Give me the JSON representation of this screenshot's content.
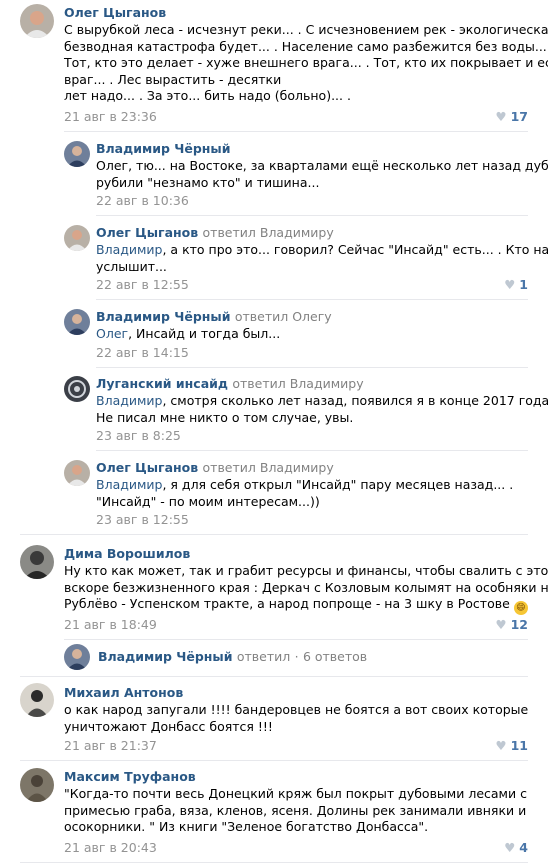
{
  "comments": [
    {
      "author": "Олег Цыганов",
      "lines": [
        "С вырубкой леса - исчезнут реки... . С исчезновением рек - экологическая",
        "безводная катастрофа будет... . Население само разбежится без воды...",
        "Тот, кто это делает - хуже внешнего врага... . Тот, кто их покрывает и есть",
        "враг... . Лес вырастить - десятки",
        "лет надо... . За это... бить надо (больно)... ."
      ],
      "date": "21 авг в 23:36",
      "likes": "17"
    },
    {
      "author": "Владимир Чёрный",
      "lines": [
        "Олег, тю... на Востоке, за кварталами ещё несколько лет назад дубы",
        "рубили \"незнамо кто\" и тишина..."
      ],
      "date": "22 авг в 10:36"
    },
    {
      "author": "Олег Цыганов",
      "reply_to": "ответил Владимиру",
      "mention": "Владимир",
      "lines": [
        ", а кто про это... говорил? Сейчас \"Инсайд\" есть... . Кто надо -",
        "услышит..."
      ],
      "date": "22 авг в 12:55",
      "likes": "1"
    },
    {
      "author": "Владимир Чёрный",
      "reply_to": "ответил Олегу",
      "mention": "Олег",
      "lines": [
        ", Инсайд и тогда был..."
      ],
      "date": "22 авг в 14:15"
    },
    {
      "author": "Луганский инсайд",
      "reply_to": "ответил Владимиру",
      "mention": "Владимир",
      "lines": [
        ", смотря сколько лет назад, появился я в конце 2017 года.",
        "Не писал мне никто о том случае, увы."
      ],
      "date": "23 авг в 8:25"
    },
    {
      "author": "Олег Цыганов",
      "reply_to": "ответил Владимиру",
      "mention": "Владимир",
      "lines": [
        ", я для себя открыл \"Инсайд\" пару месяцев назад... .",
        "\"Инсайд\" - по моим интересам...))"
      ],
      "date": "23 авг в 12:55"
    },
    {
      "author": "Дима Ворошилов",
      "lines": [
        "Ну кто как может, так и грабит ресурсы и финансы, чтобы свалить с этого",
        "вскоре безжизненного края : Деркач с Козловым колымят на особняки на",
        "Рублёво - Успенском тракте, а народ попроще - на 3 шку в Ростове"
      ],
      "emoji": "😄",
      "date": "21 авг в 18:49",
      "likes": "12"
    },
    {
      "author": "Михаил Антонов",
      "lines": [
        "о как народ запугали !!!! бандеровцев не боятся а вот своих которые",
        "уничтожают Донбасс боятся !!!"
      ],
      "date": "21 авг в 21:37",
      "likes": "11"
    },
    {
      "author": "Максим Труфанов",
      "lines": [
        "\"Когда-то почти весь Донецкий кряж был покрыт дубовыми лесами с",
        "примесью граба, вяза, кленов, ясеня. Долины рек занимали ивняки и",
        "осокорники. \" Из книги \"Зеленое богатство Донбасса\"."
      ],
      "date": "21 авг в 20:43",
      "likes": "4"
    }
  ],
  "show_replies": {
    "author": "Владимир Чёрный",
    "action": "ответил",
    "dot": "·",
    "count": "6 ответов"
  },
  "colors": {
    "link": "#2a5885",
    "meta": "#939393",
    "like": "#4a76a8"
  }
}
